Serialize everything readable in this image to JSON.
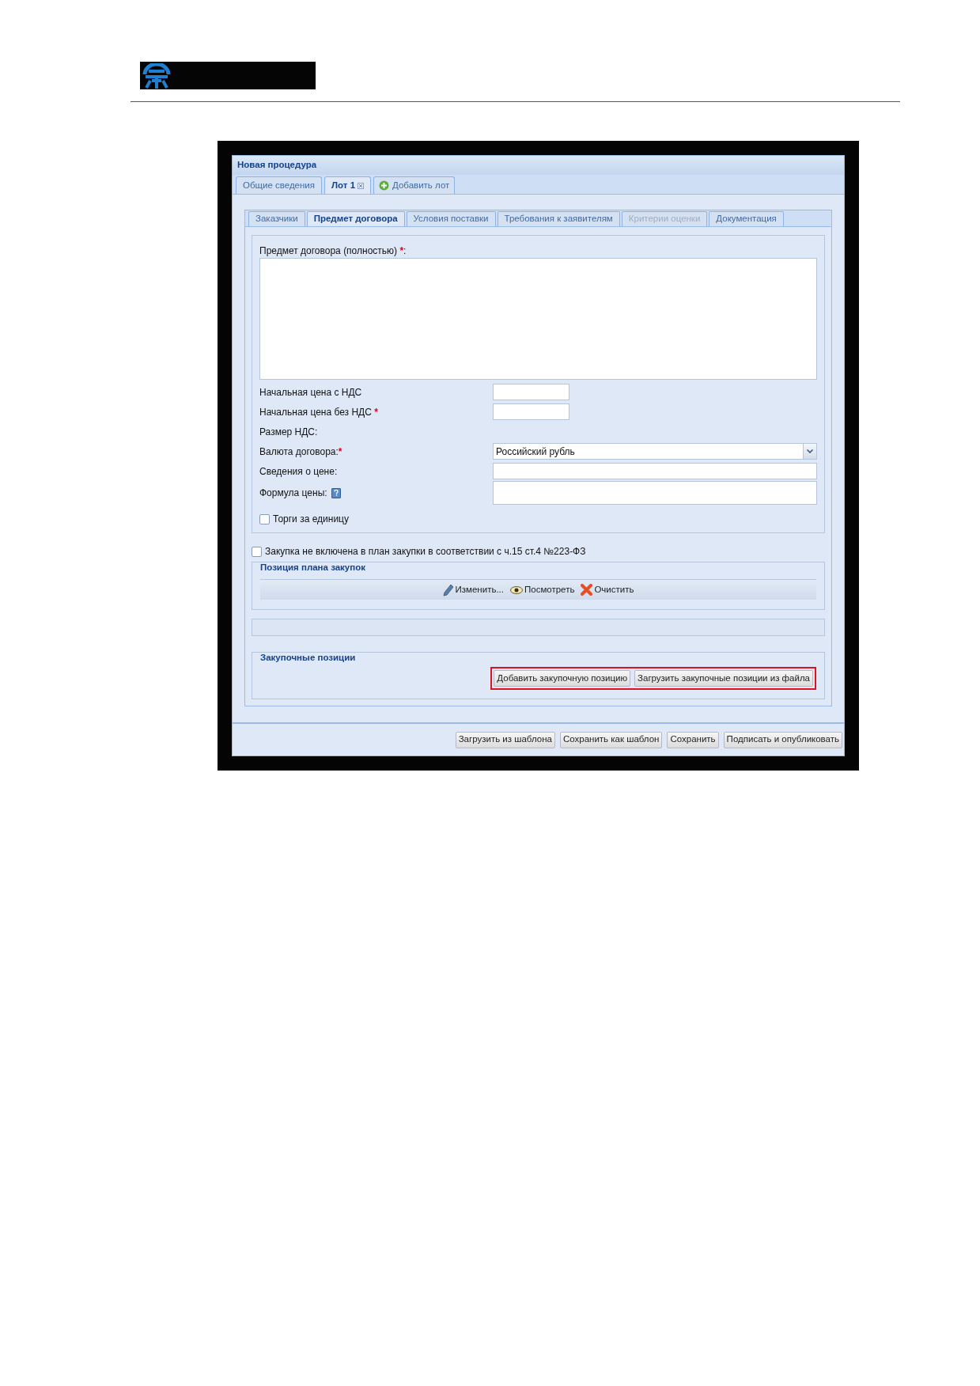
{
  "window": {
    "title": "Новая процедура"
  },
  "lot_tabs": [
    {
      "label": "Общие сведения",
      "selected": false,
      "closable": false
    },
    {
      "label": "Лот 1",
      "selected": true,
      "closable": true
    }
  ],
  "add_lot_button": {
    "label": "Добавить лот"
  },
  "section_tabs": [
    {
      "label": "Заказчики",
      "selected": false,
      "disabled": false
    },
    {
      "label": "Предмет договора",
      "selected": true,
      "disabled": false
    },
    {
      "label": "Условия поставки",
      "selected": false,
      "disabled": false
    },
    {
      "label": "Требования к заявителям",
      "selected": false,
      "disabled": false
    },
    {
      "label": "Критерии оценки",
      "selected": false,
      "disabled": true
    },
    {
      "label": "Документация",
      "selected": false,
      "disabled": false
    }
  ],
  "subject": {
    "label": "Предмет договора (полностью) ",
    "mark": "*",
    "label_end": ":"
  },
  "fields": [
    {
      "kind": "short",
      "label": "Начальная цена с НДС"
    },
    {
      "kind": "short",
      "label": "Начальная цена без НДС ",
      "mark": "*"
    },
    {
      "kind": "none",
      "label": "Размер НДС:"
    },
    {
      "kind": "select",
      "label": "Валюта договора:",
      "mark": "*",
      "value": "Российский рубль"
    },
    {
      "kind": "wide",
      "label": "Сведения о цене:"
    },
    {
      "kind": "tall",
      "label": "Формула цены:",
      "help": true
    }
  ],
  "unit_trading": {
    "label": "Торги за единицу",
    "checked": false
  },
  "not_in_plan": {
    "label": "Закупка не включена в план закупки в соответствии с ч.15 ст.4 №223-ФЗ",
    "checked": false
  },
  "plan_position": {
    "legend": "Позиция плана закупок",
    "actions": [
      {
        "kind": "edit",
        "label": "Изменить..."
      },
      {
        "kind": "view",
        "label": "Посмотреть"
      },
      {
        "kind": "clear",
        "label": "Очистить"
      }
    ]
  },
  "purchase_positions": {
    "legend": "Закупочные позиции",
    "highlighted": true,
    "buttons": [
      "Добавить закупочную позицию",
      "Загрузить закупочные позиции из файла"
    ]
  },
  "footer_buttons": [
    "Загрузить из шаблона",
    "Сохранить как шаблон",
    "Сохранить",
    "Подписать и опубликовать"
  ]
}
